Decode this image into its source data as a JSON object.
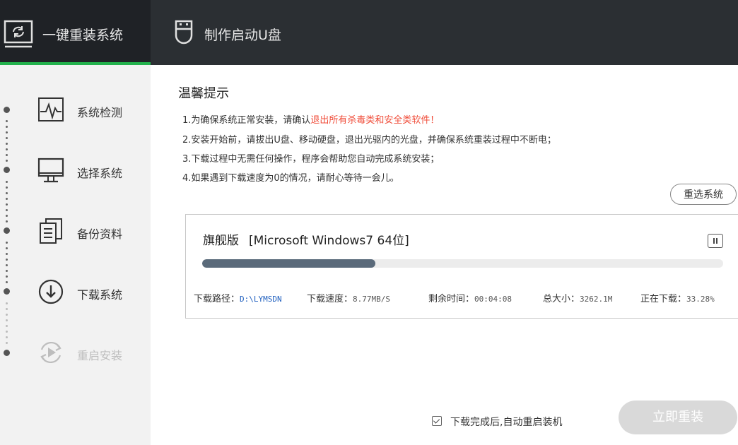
{
  "header": {
    "tabs": [
      {
        "label": "一键重装系统",
        "icon": "monitor-refresh-icon",
        "active": true
      },
      {
        "label": "制作启动U盘",
        "icon": "usb-drive-icon",
        "active": false
      }
    ]
  },
  "sidebar": {
    "steps": [
      {
        "label": "系统检测",
        "icon": "pulse-icon"
      },
      {
        "label": "选择系统",
        "icon": "monitor-icon"
      },
      {
        "label": "备份资料",
        "icon": "documents-icon"
      },
      {
        "label": "下载系统",
        "icon": "download-circle-icon"
      },
      {
        "label": "重启安装",
        "icon": "restart-play-icon"
      }
    ]
  },
  "tips": {
    "title": "温馨提示",
    "line1_prefix": "1.为确保系统正常安装，请确认",
    "line1_warn": "退出所有杀毒类和安全类软件！",
    "line2": "2.安装开始前，请拔出U盘、移动硬盘，退出光驱内的光盘，并确保系统重装过程中不断电；",
    "line3": "3.下载过程中无需任何操作，程序会帮助您自动完成系统安装；",
    "line4": "4.如果遇到下载速度为0的情况，请耐心等待一会儿。"
  },
  "reselect_label": "重选系统",
  "download": {
    "edition": "旗舰版",
    "os_name": "[Microsoft Windows7 64位]",
    "progress_fraction": 0.3328,
    "path_label": "下载路径：",
    "path_value": "D:\\LYMSDN",
    "speed_label": "下载速度：",
    "speed_value": "8.77MB/S",
    "remaining_label": "剩余时间：",
    "remaining_value": "00:04:08",
    "size_label": "总大小：",
    "size_value": "3262.1M",
    "downloading_label": "正在下载：",
    "downloading_value": "33.28%"
  },
  "auto_restart_label": "下载完成后,自动重启装机",
  "install_now_label": "立即重装",
  "colors": {
    "accent_green": "#22b14c",
    "warning": "#f04d3a",
    "progress": "#5a6a7a",
    "topbar": "#2b2f33"
  }
}
